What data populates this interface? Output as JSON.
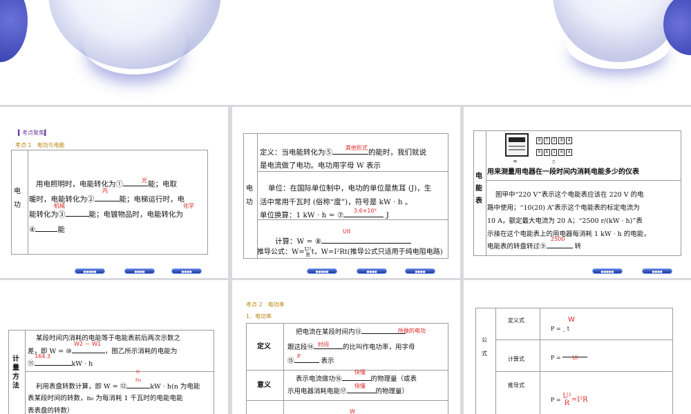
{
  "slide1": {
    "header": "▍考点聚焦▍",
    "topic": "考点 1　电功与电能",
    "row_label": "电\n\n功",
    "line1_pre": "用电照明时，电能转化为①",
    "line1_post": "能；电取",
    "line2_pre": "暖时，电能转化为②",
    "line2_post": "能；电梯运行时，电",
    "line3_pre": "能转化为③",
    "line3_post": "能；电镀物品时，电能转化为",
    "line4_pre": "④",
    "line4_post": "能",
    "ans1": "光",
    "ans2": "内",
    "ans3": "机械",
    "ans4": "化学",
    "nav": [
      "■■■■■",
      "■■■■",
      "■■■■"
    ]
  },
  "slide2": {
    "row_label": "电\n\n功",
    "def_pre": "定义：当电能转化为⑤",
    "def_post": "的能时，我们就说",
    "def_line2": "是电流做了电功。电功用字母 W 表示",
    "ans5": "其他形式",
    "unit_line1": "单位：在国际单位制中，电功的单位是焦耳 (J)，生",
    "unit_line2": "活中常用千瓦时 (俗称“度”)，符号是 kW · h 。",
    "unit_line3_pre": "单位换算：1 kW · h = ⑦",
    "unit_line3_post": "J",
    "ans7": "3.6×10⁶",
    "calc_pre": "计算：W = ⑧",
    "ans8": "UIt",
    "derive": "推导公式：W=",
    "derive_tail": "t，W=I²Rt(推导公式只适用于纯电阻电路)",
    "frac_top": "U²",
    "frac_bot": "R",
    "nav": [
      "■■■■■",
      "■■■■",
      "■■■■"
    ]
  },
  "slide3": {
    "row_label": "电\n\n能\n\n表",
    "meter_top": "0 7 1 8 4",
    "meter_bottom": "0 8 1 0 4",
    "lbl_jia": "甲",
    "lbl_yi": "乙",
    "purpose": "用来测量用电器在一段时间内消耗电能多少的仪表",
    "p1": "图甲中“220 V”表示这个电能表应该在 220 V 的电",
    "p2": "路中使用；“10(20) A”表示这个电能表的标定电流为",
    "p3": "10 A，额定最大电流为 20 A；“2500 r/(kW · h)”表",
    "p4": "示接在这个电能表上的用电器每消耗 1 kW · h 的电能，",
    "p5_pre": "电能表的转盘转过⑨",
    "p5_post": "转",
    "ans9": "2500",
    "nav": [
      "■■■■■",
      "■■■■",
      "■■■■"
    ]
  },
  "slide4": {
    "row_label": "计\n量\n方\n法",
    "l1": "某段时间内消耗的电能等于电能表前后两次示数之",
    "l2_pre": "差，即 W = ⑩",
    "l2_post": "，图乙所示消耗的电能为",
    "ans10": "W2 － W1",
    "l3_pre": "⑪",
    "l3_post": "kW · h",
    "ans11": "164.3",
    "l4_pre": "利用表盘转数计算，即 W = ⑫",
    "l4_post": "kW · h(n 为电能",
    "ans12_top": "n",
    "ans12_bot": "n₀",
    "l5": "表某段时间的转数，n₀ 为每消耗 1 千瓦时的电能电能",
    "l6": "表表盘的转数）"
  },
  "slide5": {
    "topic": "考点 2　电功率",
    "sub": "1．电功率",
    "r1_label": "定义",
    "r1_l1_pre": "把电流在某段时间内⑬",
    "r1_l2_pre": "跟这段⑭",
    "r1_l2_post": "的比叫作电功率，用字母",
    "r1_l3_pre": "⑮",
    "r1_l3_post": "表示",
    "ans13": "所做的电功",
    "ans14": "时间",
    "ans15": "P",
    "r2_label": "意义",
    "r2_l1_pre": "表示电流做功⑯",
    "r2_l1_post": "的物理量（或表",
    "r2_l2_pre": "示用电器消耗电能⑰",
    "r2_l2_post": "的物理量）",
    "ans16": "快慢",
    "ans17": "快慢",
    "ans_bottom": "W"
  },
  "slide6": {
    "side_label": "公\n\n式",
    "r1_label": "定义式",
    "r1_formula": "P = _ t",
    "r1_ans": "W",
    "r2_label": "计算式",
    "r2_formula": "P =",
    "r2_ans": "UI",
    "r3_label": "推导式",
    "r3_formula_pre": "P =",
    "r3_frac_top": "U²",
    "r3_frac_bot": "R",
    "r3_formula_post": "=I²R"
  }
}
